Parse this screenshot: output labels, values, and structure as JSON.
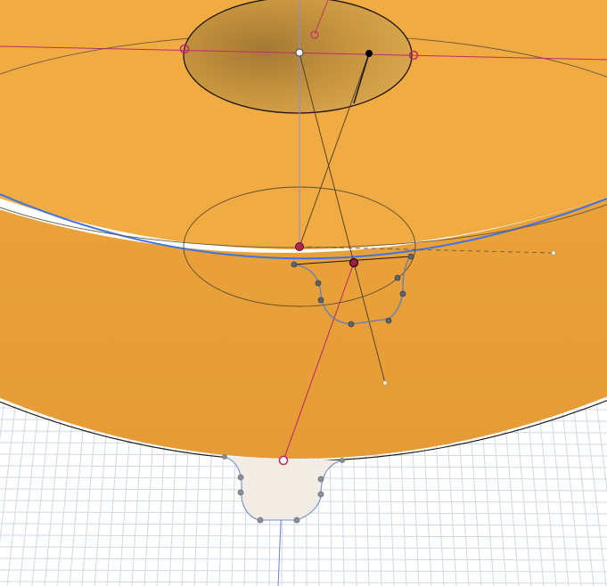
{
  "viewport": {
    "title": "",
    "background": "#ffffff",
    "grid_color": "#cfd8e3",
    "body_top_color": "#f0ac42",
    "body_side_color": "#e9a13a",
    "hole_color": "#c9963f",
    "edge_color": "#2e2a22",
    "selected_edge_color": "#3c73e6",
    "constraint_color": "#c02a6a",
    "vertical_axis_color": "#6b7fe0",
    "spline_color": "#5a7fbf",
    "control_point_color": "#5b6470"
  },
  "scene": {
    "objects": [
      {
        "id": "cylinder-body",
        "label": ""
      },
      {
        "id": "top-hole",
        "label": ""
      },
      {
        "id": "spline-profile",
        "label": ""
      },
      {
        "id": "projected-profile",
        "label": ""
      }
    ]
  }
}
